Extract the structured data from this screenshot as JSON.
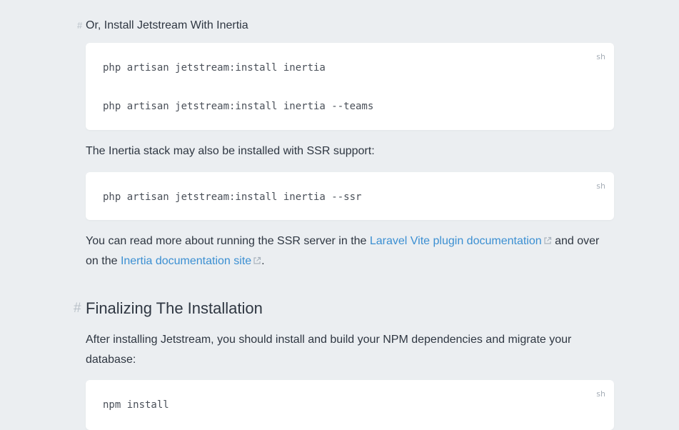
{
  "headings": {
    "install_inertia": {
      "anchor": "#",
      "text": "Or, Install Jetstream With Inertia"
    },
    "finalizing": {
      "anchor": "#",
      "text": "Finalizing The Installation"
    }
  },
  "code_blocks": {
    "inertia": {
      "lang": "sh",
      "lines": [
        "php artisan jetstream:install inertia",
        "php artisan jetstream:install inertia --teams"
      ]
    },
    "ssr": {
      "lang": "sh",
      "lines": [
        "php artisan jetstream:install inertia --ssr"
      ]
    },
    "npm": {
      "lang": "sh",
      "lines": [
        "npm install"
      ]
    }
  },
  "paragraphs": {
    "ssr_intro": "The Inertia stack may also be installed with SSR support:",
    "ssr_more": {
      "text_before": "You can read more about running the SSR server in the ",
      "link1": "Laravel Vite plugin documentation",
      "text_middle": " and over on the ",
      "link2": "Inertia documentation site",
      "text_after": "."
    },
    "finalize": "After installing Jetstream, you should install and build your NPM dependencies and migrate your database:"
  },
  "icons": {
    "external_link": "external-link-icon"
  },
  "colors": {
    "background": "#ebeef1",
    "link": "#3b8fd2",
    "anchor": "#b8c0c8",
    "code_bg": "#ffffff"
  }
}
